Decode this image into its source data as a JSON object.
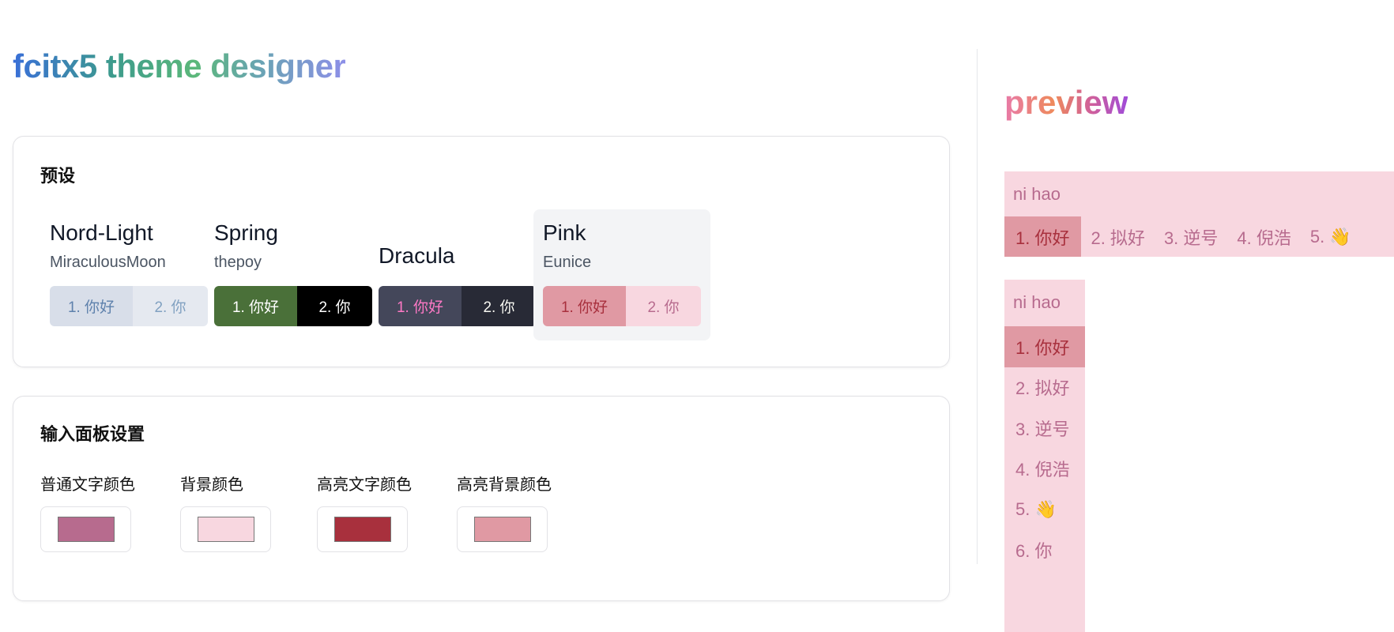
{
  "app": {
    "title": "fcitx5 theme designer"
  },
  "presets_card": {
    "title": "预设",
    "presets": [
      {
        "name": "Nord-Light",
        "author": "MiraculousMoon",
        "c1": "1. 你好",
        "c2": "2. 你",
        "bg1": "#d8dee9",
        "fg1": "#5e81ac",
        "bg2": "#e5e9f0",
        "fg2": "#81a1c1"
      },
      {
        "name": "Spring",
        "author": "thepoy",
        "c1": "1. 你好",
        "c2": "2. 你",
        "bg1": "#4a7039",
        "fg1": "#ffffff",
        "bg2": "#000000",
        "fg2": "#ffffff"
      },
      {
        "name": "Dracula",
        "author": "",
        "c1": "1. 你好",
        "c2": "2. 你",
        "bg1": "#44475a",
        "fg1": "#ff79c6",
        "bg2": "#282a36",
        "fg2": "#f8f8f2"
      },
      {
        "name": "Pink",
        "author": "Eunice",
        "c1": "1. 你好",
        "c2": "2. 你",
        "bg1": "#e099a3",
        "fg1": "#a8303d",
        "bg2": "#f8d7e0",
        "fg2": "#b76b8e"
      }
    ]
  },
  "panel_card": {
    "title": "输入面板设置",
    "fields": [
      {
        "label": "普通文字颜色",
        "color": "#b76b8e"
      },
      {
        "label": "背景颜色",
        "color": "#f8d7e0"
      },
      {
        "label": "高亮文字颜色",
        "color": "#a8303d"
      },
      {
        "label": "高亮背景颜色",
        "color": "#e099a3"
      }
    ]
  },
  "preview": {
    "title": "preview",
    "colors": {
      "text": "#b76b8e",
      "background": "#f8d7e0",
      "highlight_text": "#a8303d",
      "highlight_background": "#e099a3"
    },
    "horizontal": {
      "preedit": "ni hao",
      "candidates": [
        "1. 你好",
        "2. 拟好",
        "3. 逆号",
        "4. 倪浩",
        "5. 👋"
      ]
    },
    "vertical": {
      "preedit": "ni hao",
      "candidates": [
        "1. 你好",
        "2. 拟好",
        "3. 逆号",
        "4. 倪浩",
        "5. 👋",
        "6. 你"
      ]
    }
  }
}
